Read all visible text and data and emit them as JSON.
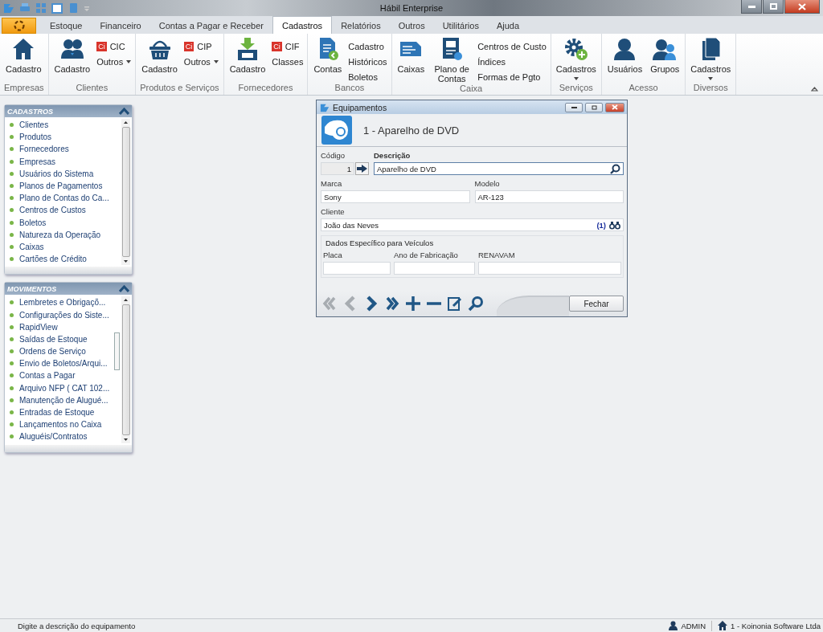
{
  "titlebar": {
    "title": "Hábil Enterprise"
  },
  "menu_tabs": [
    {
      "label": "Estoque",
      "selected": false
    },
    {
      "label": "Financeiro",
      "selected": false
    },
    {
      "label": "Contas a Pagar e Receber",
      "selected": false
    },
    {
      "label": "Cadastros",
      "selected": true
    },
    {
      "label": "Relatórios",
      "selected": false
    },
    {
      "label": "Outros",
      "selected": false
    },
    {
      "label": "Utilitários",
      "selected": false
    },
    {
      "label": "Ajuda",
      "selected": false
    }
  ],
  "ribbon": {
    "groups": [
      {
        "label": "Empresas",
        "items": [
          {
            "kind": "large",
            "label": "Cadastro",
            "dropdown": false
          }
        ]
      },
      {
        "label": "Clientes",
        "items": [
          {
            "kind": "large",
            "label": "Cadastro",
            "dropdown": false
          },
          {
            "kind": "stack",
            "entries": [
              {
                "kind": "tag",
                "badge": "Ci",
                "label": "CIC"
              },
              {
                "kind": "dropdown",
                "label": "Outros"
              }
            ]
          }
        ]
      },
      {
        "label": "Produtos e Serviços",
        "items": [
          {
            "kind": "large",
            "label": "Cadastro",
            "dropdown": false
          },
          {
            "kind": "stack",
            "entries": [
              {
                "kind": "tag",
                "badge": "Ci",
                "label": "CIP"
              },
              {
                "kind": "dropdown",
                "label": "Outros"
              }
            ]
          }
        ]
      },
      {
        "label": "Fornecedores",
        "items": [
          {
            "kind": "large",
            "label": "Cadastro",
            "dropdown": false
          },
          {
            "kind": "stack",
            "entries": [
              {
                "kind": "tag",
                "badge": "Ci",
                "label": "CIF"
              },
              {
                "kind": "text",
                "label": "Classes"
              }
            ]
          }
        ]
      },
      {
        "label": "Bancos",
        "items": [
          {
            "kind": "large",
            "label": "Contas",
            "dropdown": false
          },
          {
            "kind": "stack",
            "entries": [
              {
                "kind": "text",
                "label": "Cadastro"
              },
              {
                "kind": "text",
                "label": "Históricos"
              },
              {
                "kind": "text",
                "label": "Boletos"
              }
            ]
          }
        ]
      },
      {
        "label": "Caixa",
        "items": [
          {
            "kind": "large",
            "label": "Caixas",
            "dropdown": false
          },
          {
            "kind": "large",
            "label": "Plano de Contas",
            "dropdown": false
          },
          {
            "kind": "stack",
            "entries": [
              {
                "kind": "text",
                "label": "Centros de Custo"
              },
              {
                "kind": "text",
                "label": "Índices"
              },
              {
                "kind": "text",
                "label": "Formas de Pgto"
              }
            ]
          }
        ]
      },
      {
        "label": "Serviços",
        "items": [
          {
            "kind": "large",
            "label": "Cadastros",
            "dropdown": true
          }
        ]
      },
      {
        "label": "Acesso",
        "items": [
          {
            "kind": "large",
            "label": "Usuários",
            "dropdown": false
          },
          {
            "kind": "large",
            "label": "Grupos",
            "dropdown": false
          }
        ]
      },
      {
        "label": "Diversos",
        "items": [
          {
            "kind": "large",
            "label": "Cadastros",
            "dropdown": true
          }
        ]
      }
    ]
  },
  "sidebar": {
    "panels": [
      {
        "title": "CADASTROS",
        "items": [
          "Clientes",
          "Produtos",
          "Fornecedores",
          "Empresas",
          "Usuários do Sistema",
          "Planos de Pagamentos",
          "Plano de Contas do Ca...",
          "Centros de Custos",
          "Boletos",
          "Natureza da Operação",
          "Caixas",
          "Cartões de Crédito"
        ]
      },
      {
        "title": "MOVIMENTOS",
        "items": [
          "Lembretes e Obrigaçõ...",
          "Configurações do Siste...",
          "RapidView",
          "Saídas de Estoque",
          "Ordens de Serviço",
          "Envio de Boletos/Arqui...",
          "Contas a Pagar",
          "Arquivo NFP ( CAT 102...",
          "Manutenção de Alugué...",
          "Entradas de Estoque",
          "Lançamentos no Caixa",
          "Aluguéis/Contratos"
        ]
      }
    ]
  },
  "dialog": {
    "title": "Equipamentos",
    "heading": "1 - Aparelho de DVD",
    "codigo": {
      "label": "Código",
      "value": "1",
      "required": false
    },
    "descricao": {
      "label": "Descrição",
      "value": "Aparelho de DVD",
      "required": true
    },
    "marca": {
      "label": "Marca",
      "value": "Sony",
      "required": false
    },
    "modelo": {
      "label": "Modelo",
      "value": "AR-123",
      "required": false
    },
    "cliente": {
      "label": "Cliente",
      "value": "João das Neves",
      "code": "(1)",
      "required": false
    },
    "vehicle_section": {
      "title": "Dados Específico para Veículos",
      "fields": [
        {
          "label": "Placa"
        },
        {
          "label": "Ano de Fabricação"
        },
        {
          "label": "RENAVAM"
        }
      ]
    },
    "toolbar": [
      {
        "disabled": true
      },
      {
        "disabled": true
      },
      {
        "disabled": false
      },
      {
        "disabled": false
      },
      {
        "disabled": false
      },
      {
        "disabled": false
      },
      {
        "disabled": false
      },
      {
        "disabled": false
      }
    ],
    "close_button": "Fechar"
  },
  "status_bar": {
    "message": "Digite a descrição do equipamento",
    "user": "ADMIN",
    "company": "1 - Koinonia Software Ltda"
  }
}
